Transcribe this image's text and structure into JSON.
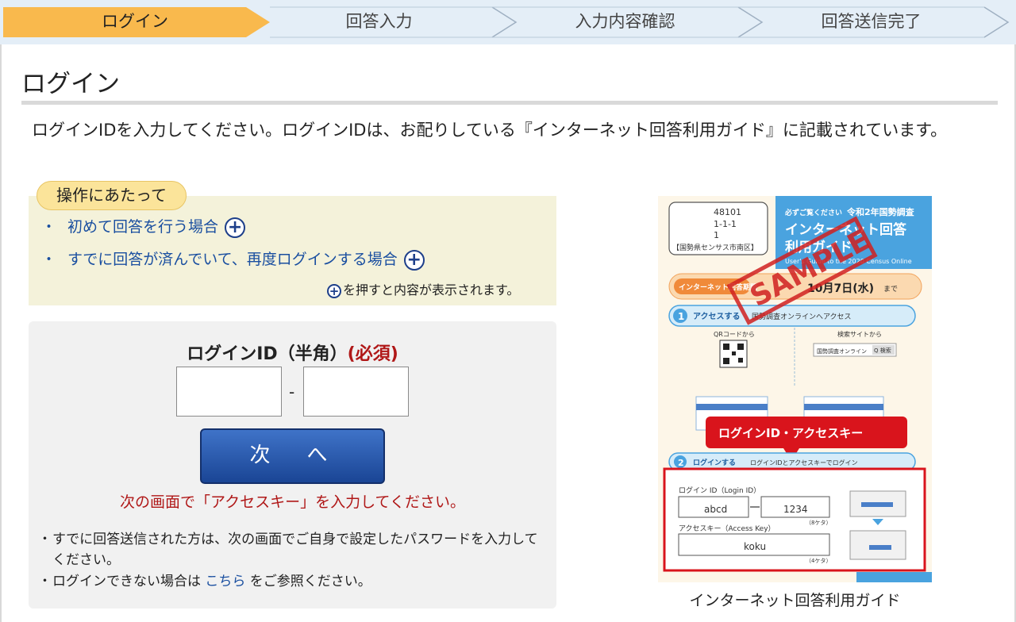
{
  "steps": [
    {
      "label": "ログイン",
      "active": true
    },
    {
      "label": "回答入力",
      "active": false
    },
    {
      "label": "入力内容確認",
      "active": false
    },
    {
      "label": "回答送信完了",
      "active": false
    }
  ],
  "page": {
    "title": "ログイン",
    "intro": "ログインIDを入力してください。ログインIDは、お配りしている『インターネット回答利用ガイド』に記載されています。"
  },
  "ops": {
    "tag": "操作にあたって",
    "items": [
      "初めて回答を行う場合",
      "すでに回答が済んでいて、再度ログインする場合"
    ],
    "note": "を押すと内容が表示されます。",
    "plus_symbol": "+"
  },
  "login": {
    "label": "ログインID（半角）",
    "required": "(必須)",
    "dash": "-",
    "field1_value": "",
    "field2_value": "",
    "next_button": "次　へ",
    "next_note": "次の画面で「アクセスキー」を入力してください。",
    "bullet1": "すでに回答送信された方は、次の画面でご自身で設定したパスワードを入力してください。",
    "bullet2_pre": "ログインできない場合は ",
    "bullet2_link": "こちら",
    "bullet2_post": " をご参照ください。"
  },
  "guide": {
    "caption": "インターネット回答利用ガイド",
    "header_small": "必ずご覧ください",
    "header_year": "令和2年国勢調査",
    "title_line1": "インターネット回答",
    "title_line2": "利用ガイド",
    "subtitle_en": "User's Guide to the 2020 Census Online",
    "addr_code1": "48101",
    "addr_code2": "1-1-1",
    "addr_code3": "1",
    "addr_place": "【国勢県センサス市南区】",
    "sample": "SAMPLE",
    "period_label": "インターネット回答期間",
    "period_end": "10月7日(水)",
    "period_until": "まで",
    "step1": "アクセスする",
    "step1_desc": "国勢調査オンラインへアクセス",
    "qr_label": "QRコードから",
    "pc_label": "検索サイトから",
    "search_text": "国勢調査オンライン",
    "search_btn": "Q 検索",
    "callout": "ログインID・アクセスキー",
    "step2": "ログインする",
    "step2_desc": "ログインIDとアクセスキーでログイン",
    "loginid_label": "ログイン ID（Login ID）",
    "loginid_a": "abcd",
    "loginid_b": "1234",
    "digits8": "（8ケタ）",
    "accesskey_label": "アクセスキー（Access Key）",
    "accesskey_val": "koku",
    "digits4": "（4ケタ）",
    "colors": {
      "header_blue": "#4aa3df",
      "callout_red": "#d9141c",
      "frame_red": "#d9141c",
      "sample_red": "#d02020"
    }
  },
  "colors": {
    "active_step": "#f9b94d",
    "inactive_step": "#e4eef7",
    "link_blue": "#1a4fa0",
    "required_red": "#b01818",
    "button_blue": "#2a5bb0"
  }
}
